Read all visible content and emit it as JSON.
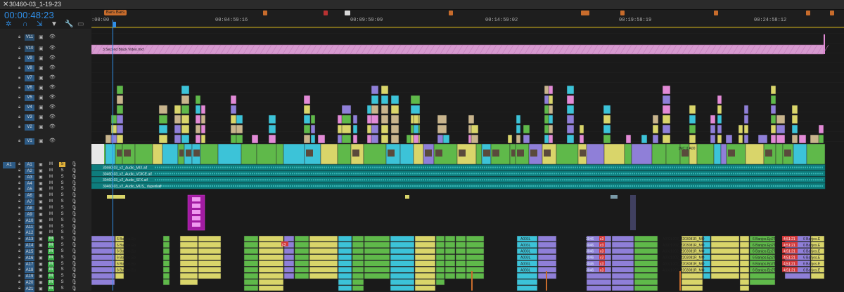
{
  "window": {
    "close_glyph": "✕",
    "sequence_tab": "30460-03_1-19-23"
  },
  "timecode": "00:00:48:23",
  "toolbar": {
    "icons": [
      "snap-icon",
      "linked-selection-icon",
      "insert-icon",
      "marker-icon",
      "wrench-icon",
      "captions-icon"
    ]
  },
  "ruler": {
    "labels": [
      ":00:00",
      "00:04:59:16",
      "00:09:59:09",
      "00:14:59:02",
      "00:19:58:19",
      "00:24:58:12"
    ],
    "marker_label": "Bars Bars",
    "marker_colors": [
      "#c86c2c",
      "#b83232",
      "#d8d8d8"
    ]
  },
  "video_tracks": [
    "V11",
    "V10",
    "V9",
    "V8",
    "V7",
    "V6",
    "V5",
    "V4",
    "V3",
    "V2",
    "V1"
  ],
  "audio_tracks": [
    "A1",
    "A2",
    "A3",
    "A4",
    "A5",
    "A6",
    "A7",
    "A8",
    "A9",
    "A10",
    "A11",
    "A12",
    "A13",
    "A14",
    "A15",
    "A16",
    "A17",
    "A18",
    "A19",
    "A20",
    "A21"
  ],
  "source_patch": "A1",
  "track_flags": {
    "mute": "M",
    "solo": "S"
  },
  "clips": {
    "black_video": "3 Second Black Video.mxf",
    "mix_clips": [
      "30460-03_v2_Audio_MIX.aif",
      "30460-03_v2_Audio_VOICE.aif",
      "30460-03_v2_Audio_SFX.aif",
      "30460-03_v2_Audio_MUS_ duped.aif"
    ],
    "multicam": "[MC1] A00",
    "banjos": "6 Banjos.Ep",
    "banjos2": "6 Banjos.Ep2T",
    "banjos3": "6 Banjos.E",
    "a003": "A003L",
    "a002": "A002L002_2203081R_MO",
    "n3046": "3046",
    "fx_badge": "c3",
    "time_badge": "4:51:21"
  },
  "colors": {
    "accent_blue": "#2f8fe8",
    "green": "#5fb94a",
    "yellow": "#d9d56a",
    "cyan": "#3cc3d8",
    "pink": "#e28ad6",
    "purple": "#8f7fd8",
    "tan": "#c8b48c",
    "audio_teal": "#0e7d7d",
    "magenta": "#a21ba2"
  }
}
